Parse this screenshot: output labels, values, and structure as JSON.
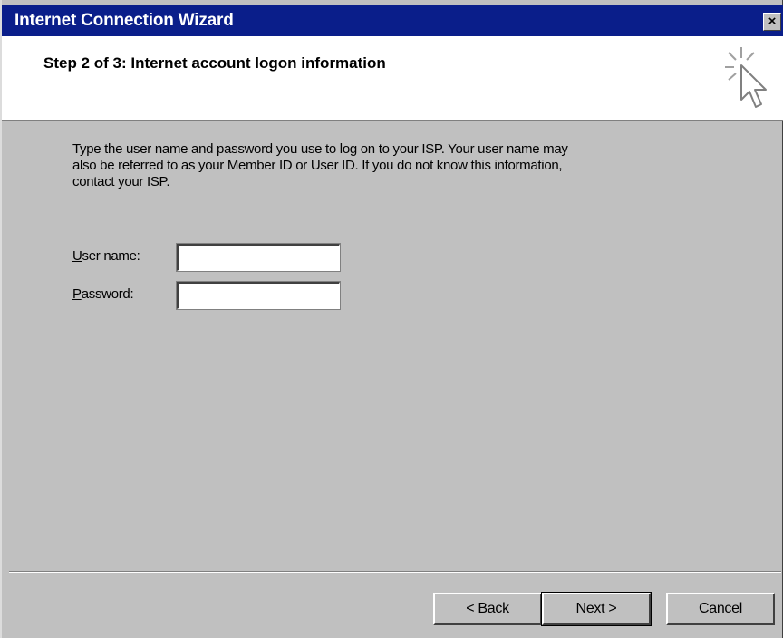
{
  "window": {
    "title": "Internet Connection Wizard",
    "close_glyph": "×"
  },
  "header": {
    "step_title": "Step 2 of 3: Internet account logon information",
    "icon": "wizard-cursor-icon"
  },
  "body": {
    "intro_line1": "Type the user name and password you use to log on to your ISP. Your user name may",
    "intro_line2": "also be referred to as your Member ID or User ID. If you do not know this information,",
    "intro_line3": "contact your ISP."
  },
  "form": {
    "username": {
      "label_accel": "U",
      "label_rest": "ser name:",
      "value": ""
    },
    "password": {
      "label_accel": "P",
      "label_rest": "assword:",
      "value": ""
    }
  },
  "buttons": {
    "back": {
      "prefix": "< ",
      "accel": "B",
      "rest": "ack"
    },
    "next": {
      "accel": "N",
      "rest": "ext >"
    },
    "cancel": {
      "label": "Cancel"
    }
  },
  "colors": {
    "titlebar": "#0a1e8a",
    "dialog_bg": "#c0c0c0",
    "header_bg": "#ffffff"
  }
}
